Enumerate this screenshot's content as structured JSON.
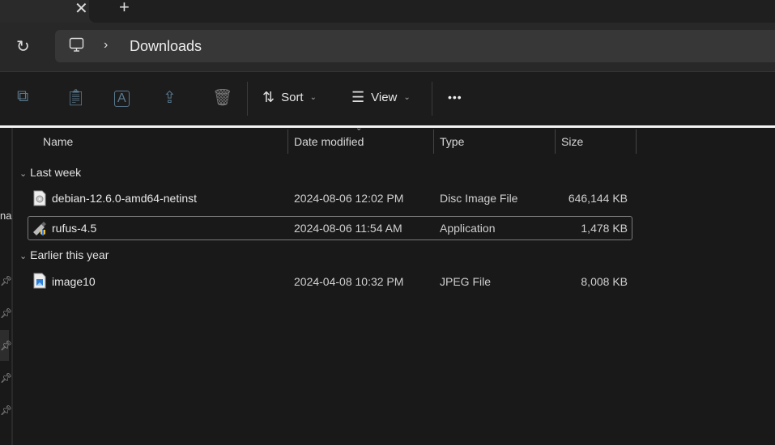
{
  "tabs": {
    "close_icon": "close-icon",
    "new_tab": "+"
  },
  "address": {
    "path": [
      "Downloads"
    ]
  },
  "toolbar": {
    "sort": "Sort",
    "view": "View",
    "more": "•••"
  },
  "columns": [
    "Name",
    "Date modified",
    "Type",
    "Size"
  ],
  "sidebar": {
    "partial_label": "na"
  },
  "groups": [
    {
      "label": "Last week",
      "files": [
        {
          "name": "debian-12.6.0-amd64-netinst",
          "date": "2024-08-06 12:02 PM",
          "type": "Disc Image File",
          "size": "646,144 KB",
          "icon": "disc-image-icon"
        },
        {
          "name": "rufus-4.5",
          "date": "2024-08-06 11:54 AM",
          "type": "Application",
          "size": "1,478 KB",
          "icon": "usb-app-icon",
          "selected": true
        }
      ]
    },
    {
      "label": "Earlier this year",
      "files": [
        {
          "name": "image10",
          "date": "2024-04-08 10:32 PM",
          "type": "JPEG File",
          "size": "8,008 KB",
          "icon": "image-file-icon"
        }
      ]
    }
  ]
}
